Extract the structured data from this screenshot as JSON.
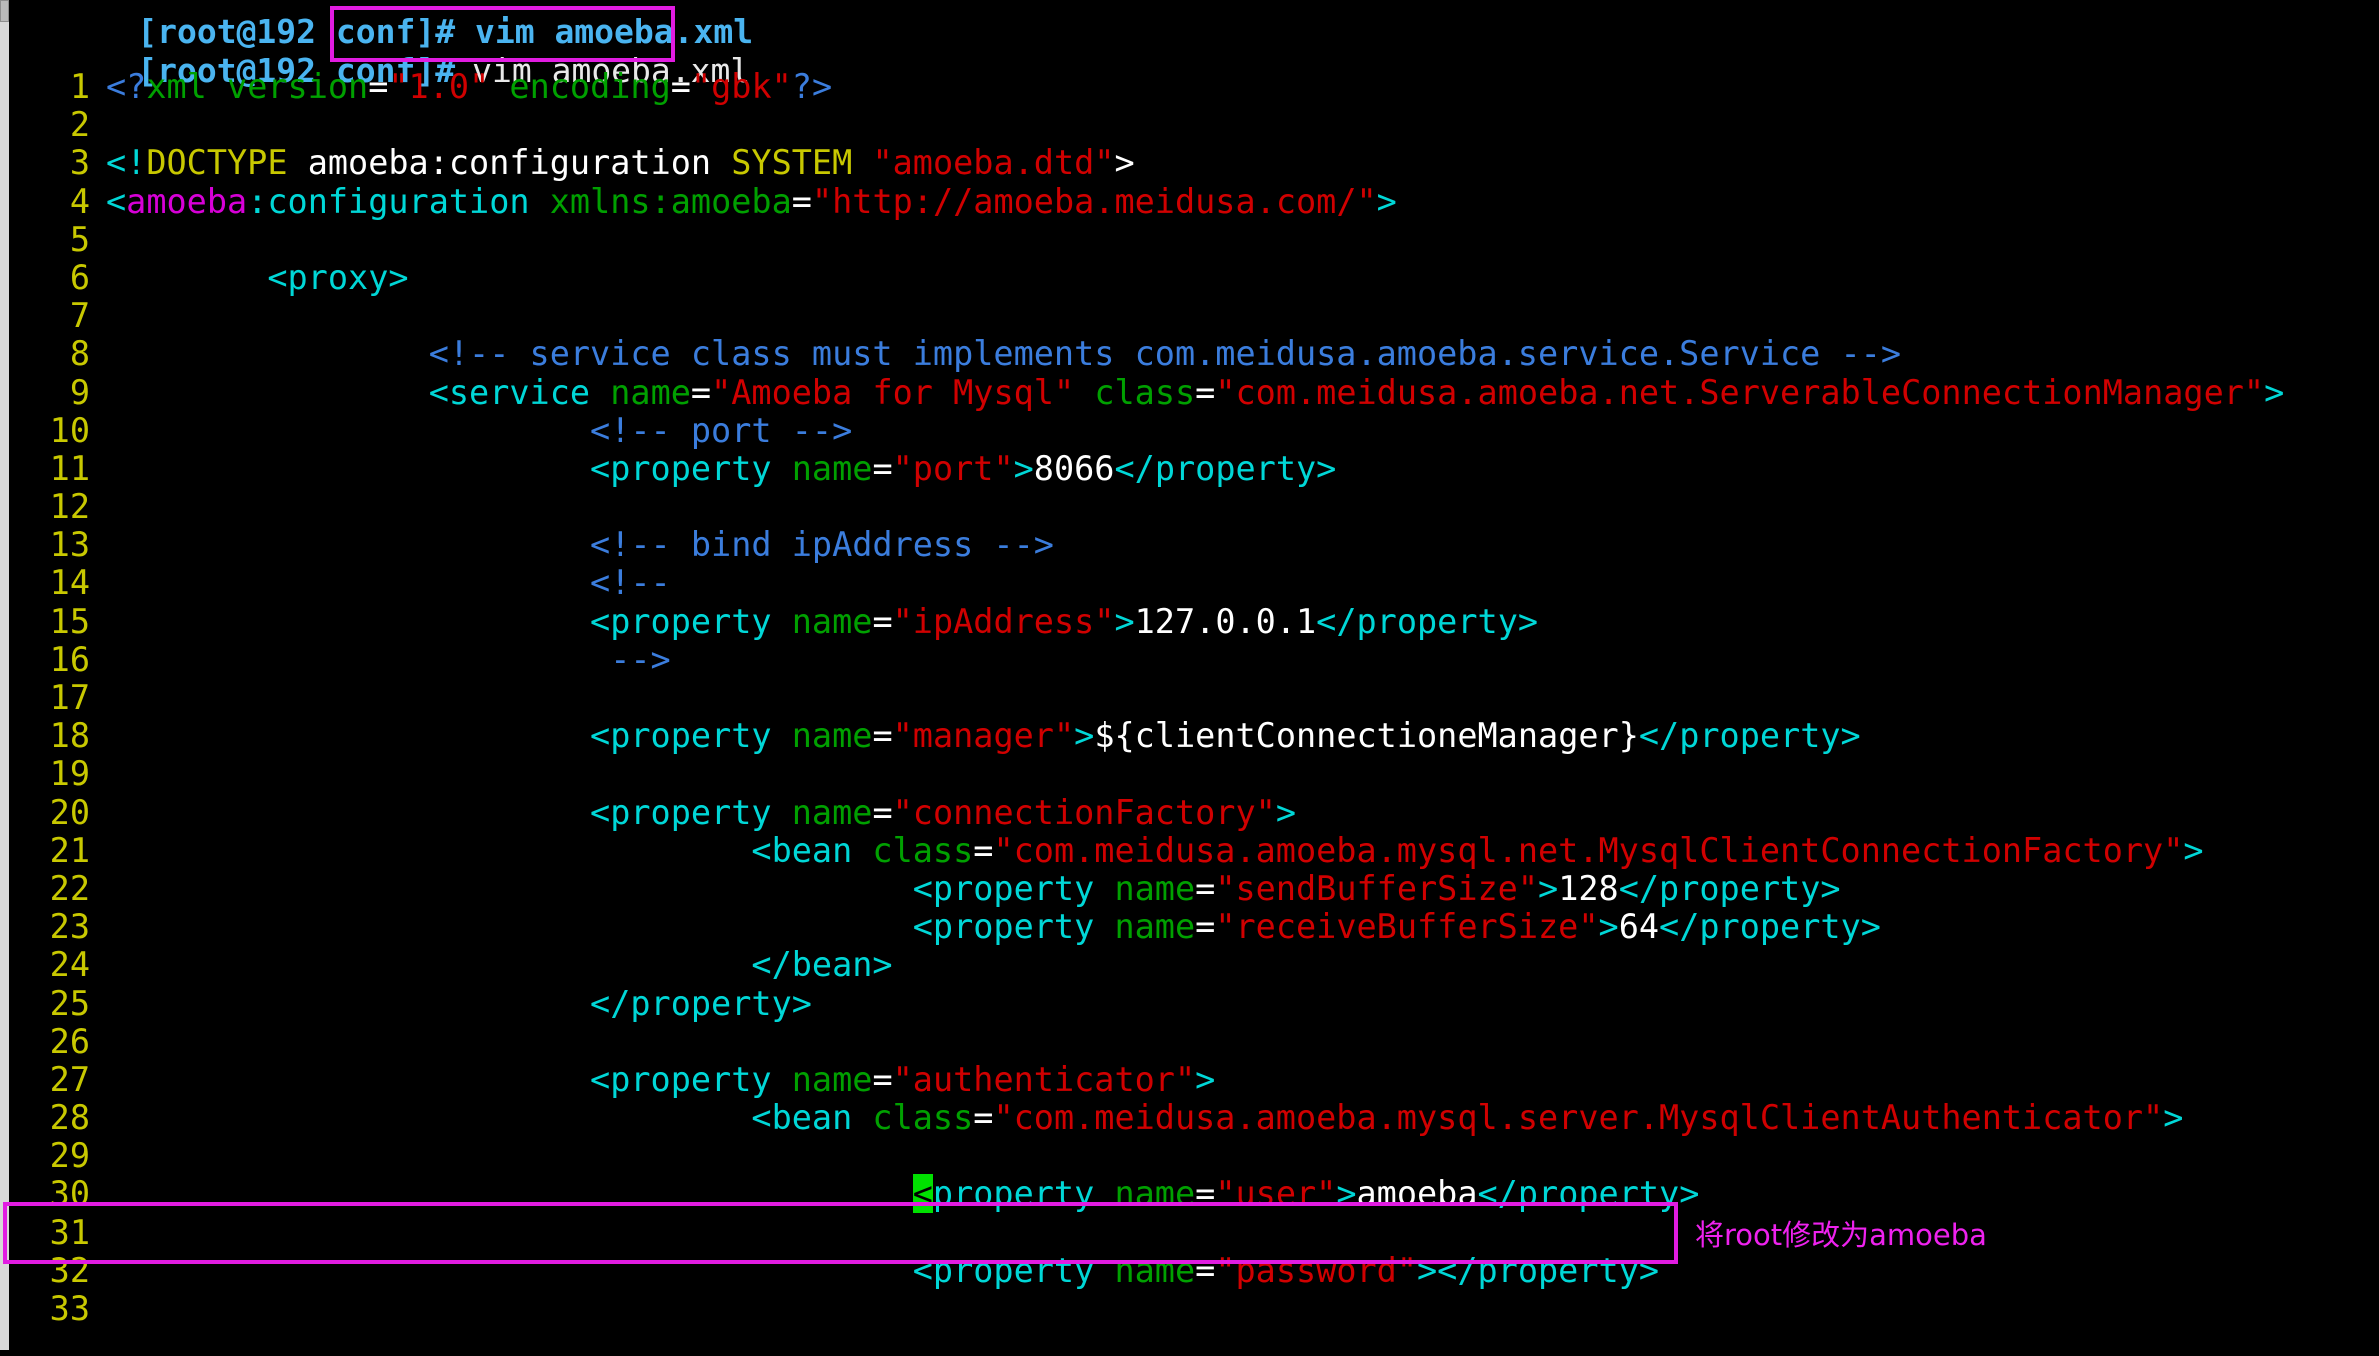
{
  "terminal": {
    "partial_prompt_line": "[root@192 conf]# vim amoeba.xml",
    "prompt": "[root@192 conf]#",
    "command": "vim amoeba.xml"
  },
  "annotations": {
    "command_box_label": "vim amoeba.xml",
    "line30_box_label": "<property name=\"user\">amoeba</property>",
    "note_text": "将root修改为amoeba",
    "color": "#e11ce1"
  },
  "editor": {
    "cursor_line": 30,
    "cursor_char": "<",
    "cursor_color": "#00e000",
    "lines": [
      {
        "n": "1",
        "segs": [
          {
            "t": "<?",
            "c": "pi"
          },
          {
            "t": "xml",
            "c": "attr"
          },
          {
            "t": " ",
            "c": "txt"
          },
          {
            "t": "version",
            "c": "attr"
          },
          {
            "t": "=",
            "c": "eq"
          },
          {
            "t": "\"1.0\"",
            "c": "str"
          },
          {
            "t": " ",
            "c": "txt"
          },
          {
            "t": "encoding",
            "c": "attr"
          },
          {
            "t": "=",
            "c": "eq"
          },
          {
            "t": "\"gbk\"",
            "c": "str"
          },
          {
            "t": "?>",
            "c": "pi"
          }
        ]
      },
      {
        "n": "2",
        "segs": []
      },
      {
        "n": "3",
        "segs": [
          {
            "t": "<!",
            "c": "tag"
          },
          {
            "t": "DOCTYPE",
            "c": "doctype"
          },
          {
            "t": " amoeba:configuration ",
            "c": "txt"
          },
          {
            "t": "SYSTEM",
            "c": "doctype"
          },
          {
            "t": " ",
            "c": "txt"
          },
          {
            "t": "\"amoeba.dtd\"",
            "c": "str"
          },
          {
            "t": ">",
            "c": "txt"
          }
        ]
      },
      {
        "n": "4",
        "segs": [
          {
            "t": "<",
            "c": "tag"
          },
          {
            "t": "amoeba",
            "c": "magenta"
          },
          {
            "t": ":",
            "c": "tag"
          },
          {
            "t": "configuration",
            "c": "tag"
          },
          {
            "t": " ",
            "c": "txt"
          },
          {
            "t": "xmlns:amoeba",
            "c": "attr"
          },
          {
            "t": "=",
            "c": "eq"
          },
          {
            "t": "\"http://amoeba.meidusa.com/\"",
            "c": "str"
          },
          {
            "t": ">",
            "c": "tag"
          }
        ]
      },
      {
        "n": "5",
        "segs": []
      },
      {
        "n": "6",
        "segs": [
          {
            "t": "        <proxy>",
            "c": "tag"
          }
        ]
      },
      {
        "n": "7",
        "segs": []
      },
      {
        "n": "8",
        "segs": [
          {
            "t": "                <!-- service class must implements com.meidusa.amoeba.service.Service -->",
            "c": "cmt"
          }
        ]
      },
      {
        "n": "9",
        "segs": [
          {
            "t": "                <service",
            "c": "tag"
          },
          {
            "t": " ",
            "c": "txt"
          },
          {
            "t": "name",
            "c": "attr"
          },
          {
            "t": "=",
            "c": "eq"
          },
          {
            "t": "\"Amoeba for Mysql\"",
            "c": "str"
          },
          {
            "t": " ",
            "c": "txt"
          },
          {
            "t": "class",
            "c": "attr"
          },
          {
            "t": "=",
            "c": "eq"
          },
          {
            "t": "\"com.meidusa.amoeba.net.ServerableConnectionManager\"",
            "c": "str"
          },
          {
            "t": ">",
            "c": "tag"
          }
        ]
      },
      {
        "n": "10",
        "segs": [
          {
            "t": "                        <!-- port -->",
            "c": "cmt"
          }
        ]
      },
      {
        "n": "11",
        "segs": [
          {
            "t": "                        <property",
            "c": "tag"
          },
          {
            "t": " ",
            "c": "txt"
          },
          {
            "t": "name",
            "c": "attr"
          },
          {
            "t": "=",
            "c": "eq"
          },
          {
            "t": "\"port\"",
            "c": "str"
          },
          {
            "t": ">",
            "c": "tag"
          },
          {
            "t": "8066",
            "c": "txt"
          },
          {
            "t": "</property>",
            "c": "tag"
          }
        ]
      },
      {
        "n": "12",
        "segs": []
      },
      {
        "n": "13",
        "segs": [
          {
            "t": "                        <!-- bind ipAddress -->",
            "c": "cmt"
          }
        ]
      },
      {
        "n": "14",
        "segs": [
          {
            "t": "                        <!--",
            "c": "cmt"
          }
        ]
      },
      {
        "n": "15",
        "segs": [
          {
            "t": "                        <property",
            "c": "tag"
          },
          {
            "t": " ",
            "c": "txt"
          },
          {
            "t": "name",
            "c": "attr"
          },
          {
            "t": "=",
            "c": "eq"
          },
          {
            "t": "\"ipAddress\"",
            "c": "str"
          },
          {
            "t": ">",
            "c": "tag"
          },
          {
            "t": "127.0.0.1",
            "c": "txt"
          },
          {
            "t": "</property>",
            "c": "tag"
          }
        ]
      },
      {
        "n": "16",
        "segs": [
          {
            "t": "                         -->",
            "c": "cmt"
          }
        ]
      },
      {
        "n": "17",
        "segs": []
      },
      {
        "n": "18",
        "segs": [
          {
            "t": "                        <property",
            "c": "tag"
          },
          {
            "t": " ",
            "c": "txt"
          },
          {
            "t": "name",
            "c": "attr"
          },
          {
            "t": "=",
            "c": "eq"
          },
          {
            "t": "\"manager\"",
            "c": "str"
          },
          {
            "t": ">",
            "c": "tag"
          },
          {
            "t": "${clientConnectioneManager}",
            "c": "txt"
          },
          {
            "t": "</property>",
            "c": "tag"
          }
        ]
      },
      {
        "n": "19",
        "segs": []
      },
      {
        "n": "20",
        "segs": [
          {
            "t": "                        <property",
            "c": "tag"
          },
          {
            "t": " ",
            "c": "txt"
          },
          {
            "t": "name",
            "c": "attr"
          },
          {
            "t": "=",
            "c": "eq"
          },
          {
            "t": "\"connectionFactory\"",
            "c": "str"
          },
          {
            "t": ">",
            "c": "tag"
          }
        ]
      },
      {
        "n": "21",
        "segs": [
          {
            "t": "                                <bean",
            "c": "tag"
          },
          {
            "t": " ",
            "c": "txt"
          },
          {
            "t": "class",
            "c": "attr"
          },
          {
            "t": "=",
            "c": "eq"
          },
          {
            "t": "\"com.meidusa.amoeba.mysql.net.MysqlClientConnectionFactory\"",
            "c": "str"
          },
          {
            "t": ">",
            "c": "tag"
          }
        ]
      },
      {
        "n": "22",
        "segs": [
          {
            "t": "                                        <property",
            "c": "tag"
          },
          {
            "t": " ",
            "c": "txt"
          },
          {
            "t": "name",
            "c": "attr"
          },
          {
            "t": "=",
            "c": "eq"
          },
          {
            "t": "\"sendBufferSize\"",
            "c": "str"
          },
          {
            "t": ">",
            "c": "tag"
          },
          {
            "t": "128",
            "c": "txt"
          },
          {
            "t": "</property>",
            "c": "tag"
          }
        ]
      },
      {
        "n": "23",
        "segs": [
          {
            "t": "                                        <property",
            "c": "tag"
          },
          {
            "t": " ",
            "c": "txt"
          },
          {
            "t": "name",
            "c": "attr"
          },
          {
            "t": "=",
            "c": "eq"
          },
          {
            "t": "\"receiveBufferSize\"",
            "c": "str"
          },
          {
            "t": ">",
            "c": "tag"
          },
          {
            "t": "64",
            "c": "txt"
          },
          {
            "t": "</property>",
            "c": "tag"
          }
        ]
      },
      {
        "n": "24",
        "segs": [
          {
            "t": "                                </bean>",
            "c": "tag"
          }
        ]
      },
      {
        "n": "25",
        "segs": [
          {
            "t": "                        </property>",
            "c": "tag"
          }
        ]
      },
      {
        "n": "26",
        "segs": []
      },
      {
        "n": "27",
        "segs": [
          {
            "t": "                        <property",
            "c": "tag"
          },
          {
            "t": " ",
            "c": "txt"
          },
          {
            "t": "name",
            "c": "attr"
          },
          {
            "t": "=",
            "c": "eq"
          },
          {
            "t": "\"authenticator\"",
            "c": "str"
          },
          {
            "t": ">",
            "c": "tag"
          }
        ]
      },
      {
        "n": "28",
        "segs": [
          {
            "t": "                                <bean",
            "c": "tag"
          },
          {
            "t": " ",
            "c": "txt"
          },
          {
            "t": "class",
            "c": "attr"
          },
          {
            "t": "=",
            "c": "eq"
          },
          {
            "t": "\"com.meidusa.amoeba.mysql.server.MysqlClientAuthenticator\"",
            "c": "str"
          },
          {
            "t": ">",
            "c": "tag"
          }
        ]
      },
      {
        "n": "29",
        "segs": []
      },
      {
        "n": "30",
        "segs": [
          {
            "t": "                                        ",
            "c": "txt"
          },
          {
            "t": "<",
            "c": "cursor"
          },
          {
            "t": "property",
            "c": "tag"
          },
          {
            "t": " ",
            "c": "txt"
          },
          {
            "t": "name",
            "c": "attr"
          },
          {
            "t": "=",
            "c": "eq"
          },
          {
            "t": "\"user\"",
            "c": "str"
          },
          {
            "t": ">",
            "c": "tag"
          },
          {
            "t": "amoeba",
            "c": "txt"
          },
          {
            "t": "</property>",
            "c": "tag"
          }
        ]
      },
      {
        "n": "31",
        "segs": []
      },
      {
        "n": "32",
        "segs": [
          {
            "t": "                                        <property",
            "c": "tag"
          },
          {
            "t": " ",
            "c": "txt"
          },
          {
            "t": "name",
            "c": "attr"
          },
          {
            "t": "=",
            "c": "eq"
          },
          {
            "t": "\"password\"",
            "c": "str"
          },
          {
            "t": ">",
            "c": "tag"
          },
          {
            "t": "</property>",
            "c": "tag"
          }
        ]
      },
      {
        "n": "33",
        "segs": []
      }
    ]
  },
  "colors": {
    "background": "#000000",
    "lineno": "#c8c800",
    "tag": "#00d7d7",
    "attr": "#00a000",
    "string": "#d00000",
    "comment": "#3b7ddd",
    "text": "#ffffff",
    "prompt": "#4ab4f0",
    "annotation": "#e11ce1"
  }
}
